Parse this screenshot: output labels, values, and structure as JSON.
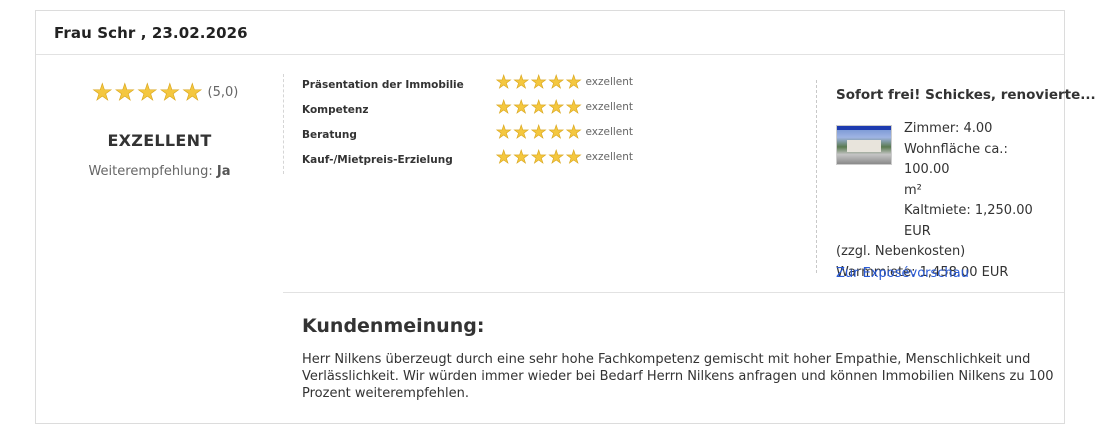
{
  "header": {
    "title": "Frau Schr , 23.02.2026"
  },
  "summary": {
    "stars": 5,
    "score_text": "(5,0)",
    "grade": "EXZELLENT",
    "recommend_label": "Weiterempfehlung:",
    "recommend_value": "Ja"
  },
  "criteria": [
    {
      "label": "Präsentation der Immobilie",
      "stars": 5,
      "rating": "exzellent"
    },
    {
      "label": "Kompetenz",
      "stars": 5,
      "rating": "exzellent"
    },
    {
      "label": "Beratung",
      "stars": 5,
      "rating": "exzellent"
    },
    {
      "label": "Kauf-/Mietpreis-Erzielung",
      "stars": 5,
      "rating": "exzellent"
    }
  ],
  "property": {
    "title": "Sofort frei! Schickes, renovierte...",
    "rooms": "Zimmer: 4.00",
    "area_1": "Wohnfläche ca.: 100.00",
    "area_2": "m²",
    "cold_rent_1": "Kaltmiete: 1,250.00 EUR",
    "cold_rent_2": "(zzgl. Nebenkosten)",
    "warm_rent": "Warmmiete: 1,458.00 EUR",
    "link": "Zur Exposévorschau"
  },
  "opinion": {
    "heading": "Kundenmeinung:",
    "text": "Herr Nilkens überzeugt durch eine sehr hohe Fachkompetenz gemischt mit hoher Empathie, Menschlichkeit und Verlässlichkeit. Wir würden immer wieder bei Bedarf Herrn Nilkens anfragen und können Immobilien Nilkens zu 100 Prozent weiterempfehlen."
  },
  "colors": {
    "star": "#f4c73f",
    "link": "#2a5bd7"
  }
}
